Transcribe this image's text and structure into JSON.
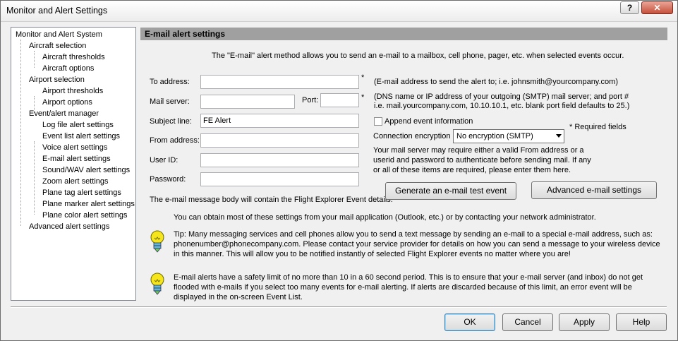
{
  "window": {
    "title": "Monitor and Alert Settings",
    "help_label": "?",
    "close_label": "✕"
  },
  "tree": {
    "items": [
      {
        "label": "Monitor and Alert System",
        "level": 0
      },
      {
        "label": "Aircraft selection",
        "level": 1
      },
      {
        "label": "Aircraft thresholds",
        "level": 2
      },
      {
        "label": "Aircraft options",
        "level": 2
      },
      {
        "label": "Airport selection",
        "level": 1
      },
      {
        "label": "Airport thresholds",
        "level": 2
      },
      {
        "label": "Airport options",
        "level": 2
      },
      {
        "label": "Event/alert manager",
        "level": 1
      },
      {
        "label": "Log file alert settings",
        "level": 2
      },
      {
        "label": "Event list alert settings",
        "level": 2
      },
      {
        "label": "Voice alert settings",
        "level": 2
      },
      {
        "label": "E-mail alert settings",
        "level": 2
      },
      {
        "label": "Sound/WAV alert settings",
        "level": 2
      },
      {
        "label": "Zoom alert settings",
        "level": 2
      },
      {
        "label": "Plane tag alert settings",
        "level": 2
      },
      {
        "label": "Plane marker alert settings",
        "level": 2
      },
      {
        "label": "Plane color alert settings",
        "level": 2
      },
      {
        "label": "Advanced alert settings",
        "level": 1
      }
    ]
  },
  "panel": {
    "header": "E-mail alert settings",
    "intro": "The \"E-mail\" alert method allows you to send an e-mail to a mailbox, cell phone, pager, etc. when selected events occur.",
    "fields": {
      "to_label": "To address:",
      "to_value": "",
      "to_required": "*",
      "to_hint": "(E-mail address to send the alert to; i.e. johnsmith@yourcompany.com)",
      "server_label": "Mail server:",
      "server_value": "",
      "port_label": "Port:",
      "port_value": "",
      "server_required": "*",
      "server_hint_1": "(DNS name or IP address of your outgoing (SMTP) mail server; and port #",
      "server_hint_2": "i.e. mail.yourcompany.com, 10.10.10.1, etc.  blank port field defaults to 25.)",
      "subject_label": "Subject line:",
      "subject_value": "FE Alert",
      "from_label": "From address:",
      "from_value": "",
      "userid_label": "User ID:",
      "userid_value": "",
      "password_label": "Password:",
      "password_value": ""
    },
    "append_label": "Append event information",
    "append_checked": false,
    "encryption_label": "Connection encryption",
    "encryption_value": "No encryption (SMTP)",
    "required_note": "* Required fields",
    "auth_note": "Your mail server may require either a valid From address or a userid and password to authenticate before sending mail.  If any or all of these items are required, please enter them here.",
    "body_note": "The e-mail message body will contain the Flight Explorer Event details.",
    "test_button": "Generate an e-mail test event",
    "advanced_button": "Advanced e-mail settings",
    "obtain_note": "You can obtain most of these settings from your mail application (Outlook, etc.) or by contacting your network administrator.",
    "tip": "Tip: Many messaging services and cell phones allow you to send a text message by sending an e-mail to a special e-mail address, such as: phonenumber@phonecompany.com.  Please contact your service provider for details on how you can send a message to your wireless device in this manner.  This will allow you to be notified instantly of selected Flight Explorer events no matter where you are!",
    "limit_note": "E-mail alerts have a safety limit of no more than 10 in a 60 second period.  This is to ensure that your e-mail server (and inbox) do not get flooded with e-mails if you select too many events for e-mail alerting.  If alerts are discarded because of this limit, an error event will be displayed in the on-screen Event List."
  },
  "buttons": {
    "ok": "OK",
    "cancel": "Cancel",
    "apply": "Apply",
    "help": "Help"
  }
}
